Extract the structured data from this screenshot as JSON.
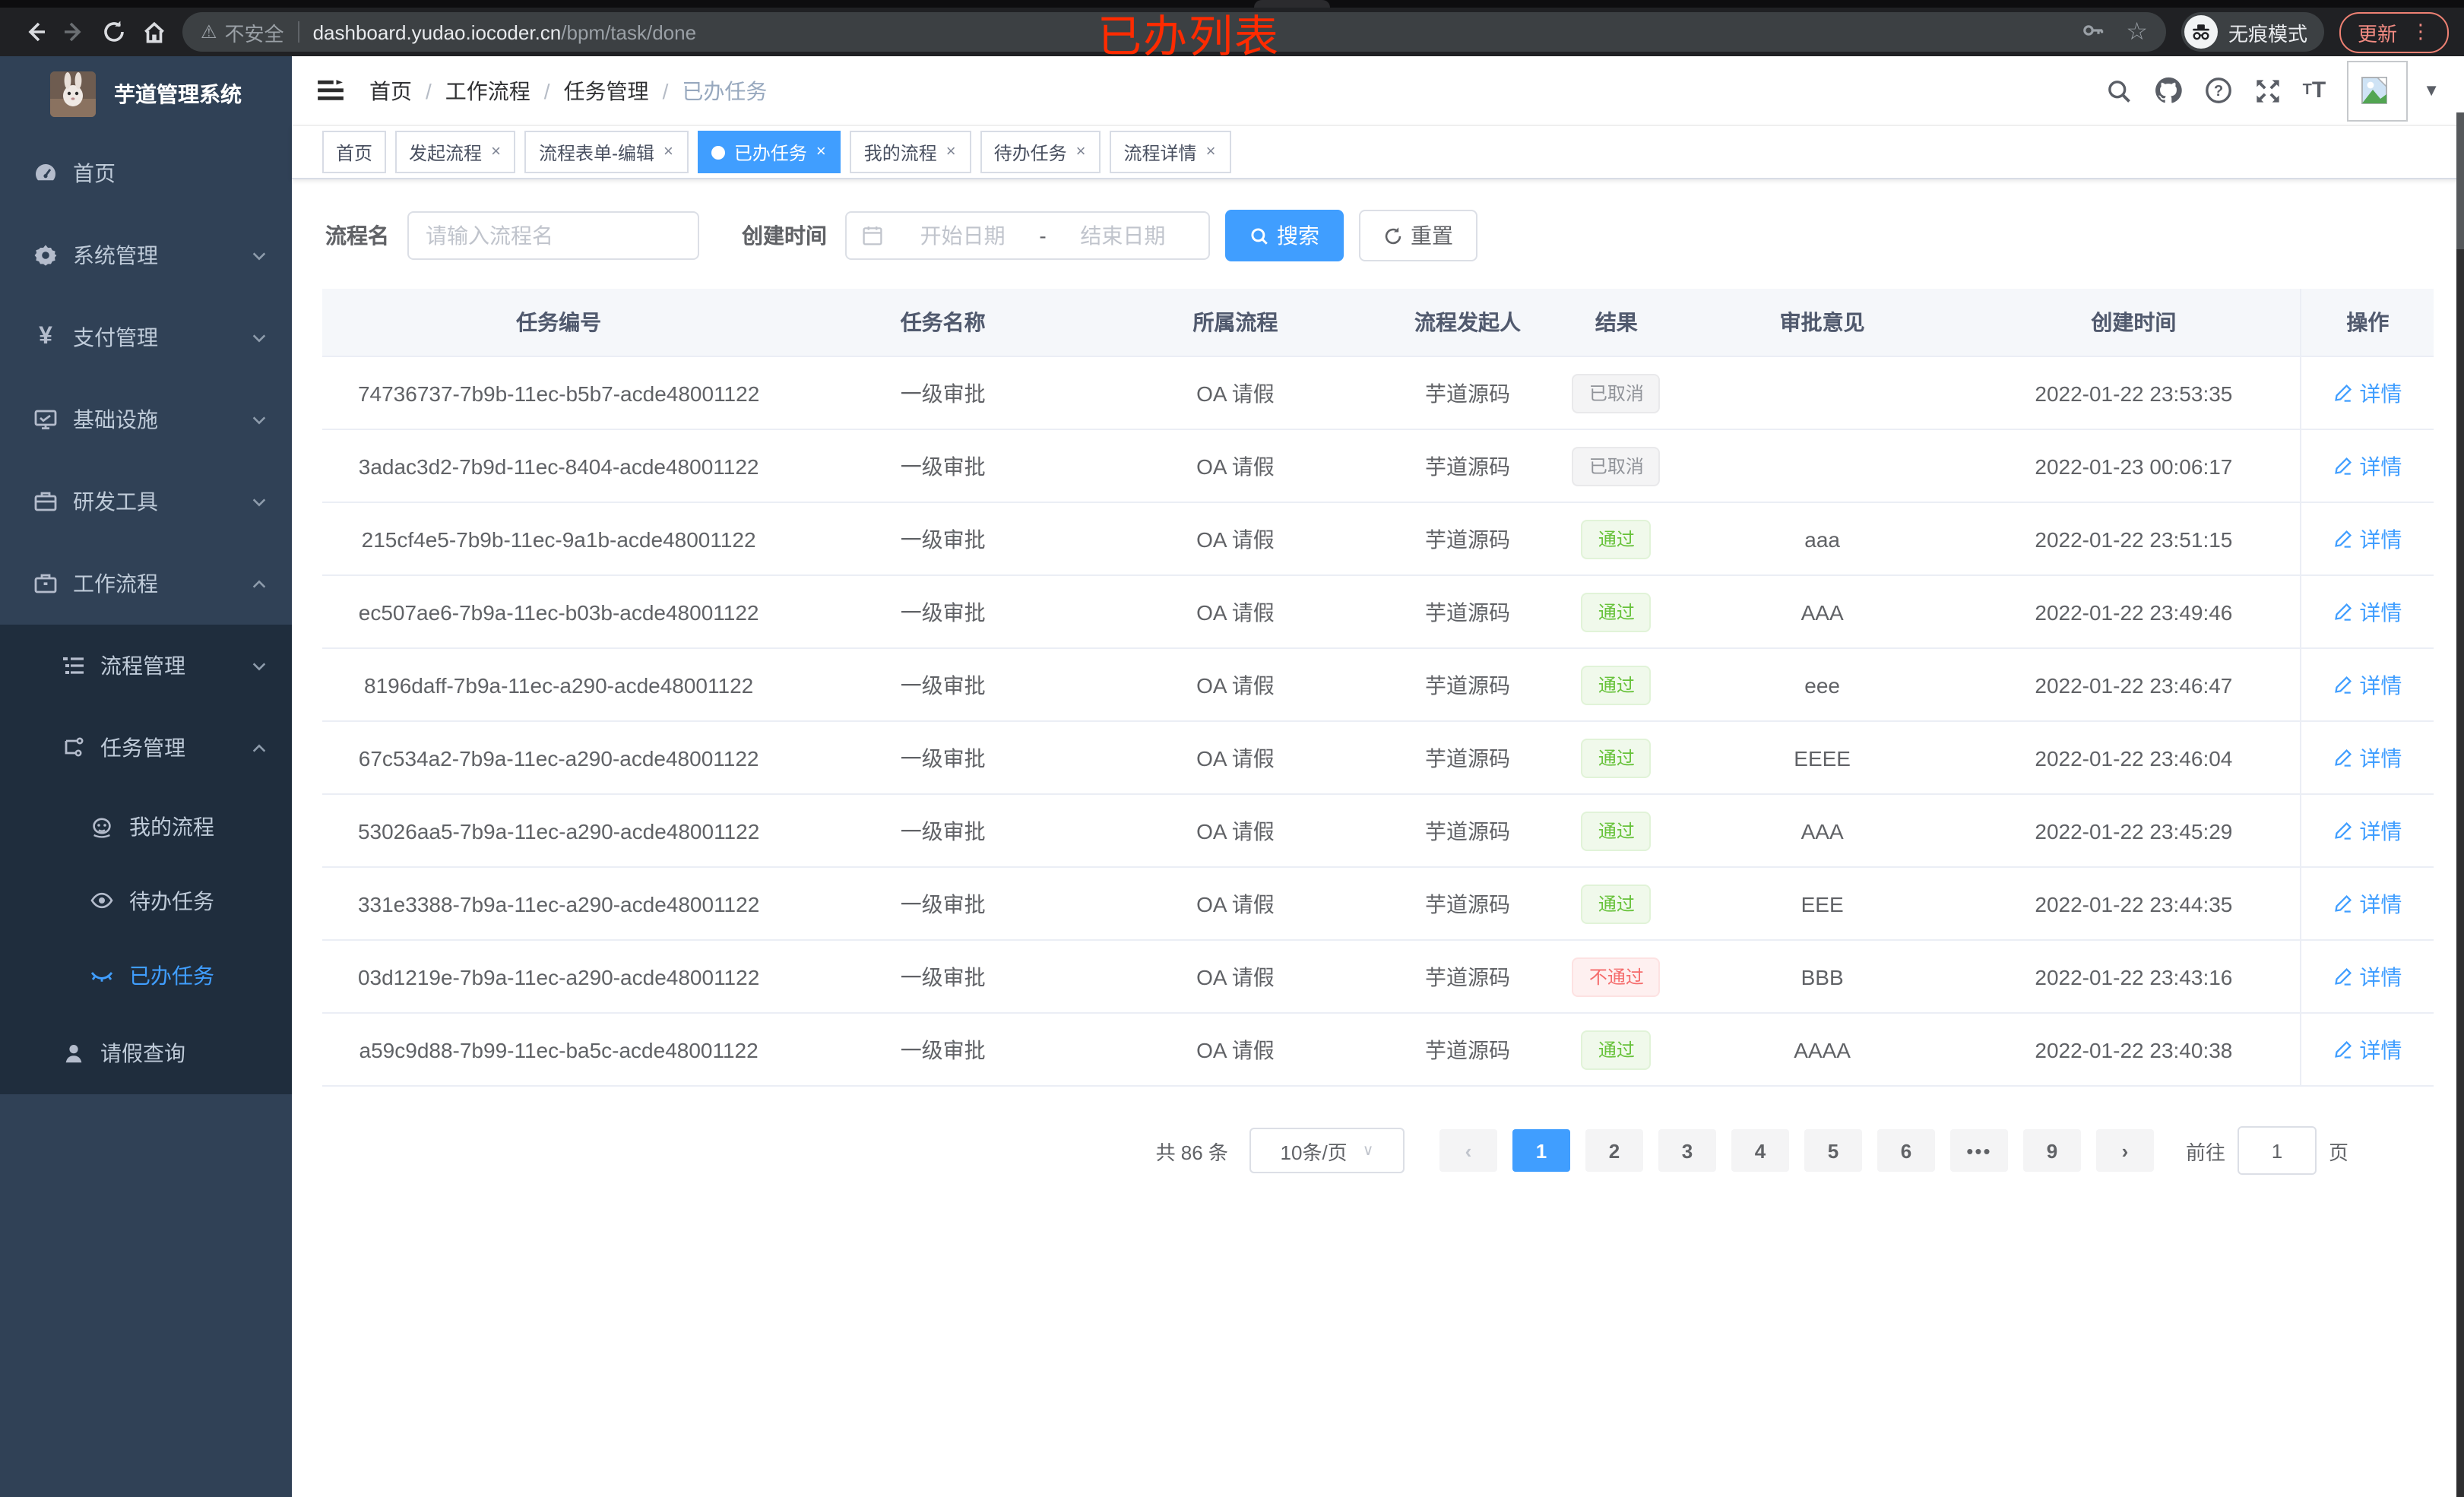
{
  "annotation": {
    "text": "已办列表",
    "color": "#ff2b00"
  },
  "browser": {
    "security_label": "不安全",
    "url_host": "dashboard.yudao.iocoder.cn",
    "url_path": "/bpm/task/done",
    "incognito_label": "无痕模式",
    "update_label": "更新"
  },
  "icons": {
    "warning": "⚠",
    "star": "☆",
    "home": "⌂",
    "caret_down": "▾",
    "more_vertical": "⋮",
    "ellipsis": "•••",
    "yen": "¥"
  },
  "sidebar": {
    "title": "芋道管理系统",
    "home": "首页",
    "system": "系统管理",
    "payment": "支付管理",
    "infra": "基础设施",
    "devtools": "研发工具",
    "workflow": "工作流程",
    "process_mgmt": "流程管理",
    "task_mgmt": "任务管理",
    "my_process": "我的流程",
    "todo_tasks": "待办任务",
    "done_tasks": "已办任务",
    "leave_query": "请假查询"
  },
  "breadcrumb": {
    "items": [
      "首页",
      "工作流程",
      "任务管理",
      "已办任务"
    ]
  },
  "tags": {
    "items": [
      {
        "label": "首页"
      },
      {
        "label": "发起流程"
      },
      {
        "label": "流程表单-编辑"
      },
      {
        "label": "已办任务"
      },
      {
        "label": "我的流程"
      },
      {
        "label": "待办任务"
      },
      {
        "label": "流程详情"
      }
    ],
    "close_glyph": "×",
    "active_index": 3
  },
  "search": {
    "name_label": "流程名",
    "name_placeholder": "请输入流程名",
    "date_label": "创建时间",
    "date_start_placeholder": "开始日期",
    "date_separator": "-",
    "date_end_placeholder": "结束日期",
    "search_button": "搜索",
    "reset_button": "重置"
  },
  "table": {
    "columns": [
      "任务编号",
      "任务名称",
      "所属流程",
      "流程发起人",
      "结果",
      "审批意见",
      "创建时间",
      "操作"
    ],
    "detail_label": "详情",
    "rows": [
      {
        "id": "74736737-7b9b-11ec-b5b7-acde48001122",
        "name": "一级审批",
        "process": "OA 请假",
        "initiator": "芋道源码",
        "result": "已取消",
        "result_type": "info",
        "comment": "",
        "created": "2022-01-22 23:53:35"
      },
      {
        "id": "3adac3d2-7b9d-11ec-8404-acde48001122",
        "name": "一级审批",
        "process": "OA 请假",
        "initiator": "芋道源码",
        "result": "已取消",
        "result_type": "info",
        "comment": "",
        "created": "2022-01-23 00:06:17"
      },
      {
        "id": "215cf4e5-7b9b-11ec-9a1b-acde48001122",
        "name": "一级审批",
        "process": "OA 请假",
        "initiator": "芋道源码",
        "result": "通过",
        "result_type": "success",
        "comment": "aaa",
        "created": "2022-01-22 23:51:15"
      },
      {
        "id": "ec507ae6-7b9a-11ec-b03b-acde48001122",
        "name": "一级审批",
        "process": "OA 请假",
        "initiator": "芋道源码",
        "result": "通过",
        "result_type": "success",
        "comment": "AAA",
        "created": "2022-01-22 23:49:46"
      },
      {
        "id": "8196daff-7b9a-11ec-a290-acde48001122",
        "name": "一级审批",
        "process": "OA 请假",
        "initiator": "芋道源码",
        "result": "通过",
        "result_type": "success",
        "comment": "eee",
        "created": "2022-01-22 23:46:47"
      },
      {
        "id": "67c534a2-7b9a-11ec-a290-acde48001122",
        "name": "一级审批",
        "process": "OA 请假",
        "initiator": "芋道源码",
        "result": "通过",
        "result_type": "success",
        "comment": "EEEE",
        "created": "2022-01-22 23:46:04"
      },
      {
        "id": "53026aa5-7b9a-11ec-a290-acde48001122",
        "name": "一级审批",
        "process": "OA 请假",
        "initiator": "芋道源码",
        "result": "通过",
        "result_type": "success",
        "comment": "AAA",
        "created": "2022-01-22 23:45:29"
      },
      {
        "id": "331e3388-7b9a-11ec-a290-acde48001122",
        "name": "一级审批",
        "process": "OA 请假",
        "initiator": "芋道源码",
        "result": "通过",
        "result_type": "success",
        "comment": "EEE",
        "created": "2022-01-22 23:44:35"
      },
      {
        "id": "03d1219e-7b9a-11ec-a290-acde48001122",
        "name": "一级审批",
        "process": "OA 请假",
        "initiator": "芋道源码",
        "result": "不通过",
        "result_type": "danger",
        "comment": "BBB",
        "created": "2022-01-22 23:43:16"
      },
      {
        "id": "a59c9d88-7b99-11ec-ba5c-acde48001122",
        "name": "一级审批",
        "process": "OA 请假",
        "initiator": "芋道源码",
        "result": "通过",
        "result_type": "success",
        "comment": "AAAA",
        "created": "2022-01-22 23:40:38"
      }
    ]
  },
  "pagination": {
    "total": "共 86 条",
    "page_size": "10条/页",
    "prev_glyph": "‹",
    "next_glyph": "›",
    "pages": [
      "1",
      "2",
      "3",
      "4",
      "5",
      "6",
      "•••",
      "9"
    ],
    "active_page": "1",
    "goto_label": "前往",
    "goto_value": "1",
    "page_unit": "页"
  },
  "colors": {
    "accent": "#409eff",
    "success": "#67c23a",
    "danger": "#f56c6c",
    "info": "#909399",
    "sidebar_bg": "#304156",
    "submenu_bg": "#1f2d3d",
    "chrome_bg": "#202124",
    "update_red": "#f28b82"
  }
}
